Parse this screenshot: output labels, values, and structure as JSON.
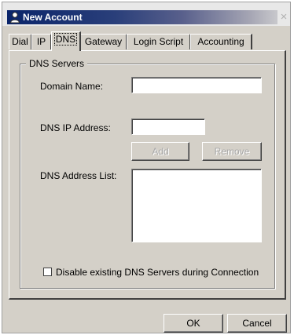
{
  "window": {
    "title": "New Account",
    "close_glyph": "×",
    "icon": "user-account-icon"
  },
  "tabs": [
    {
      "label": "Dial",
      "active": false
    },
    {
      "label": "IP",
      "active": false
    },
    {
      "label": "DNS",
      "active": true
    },
    {
      "label": "Gateway",
      "active": false
    },
    {
      "label": "Login Script",
      "active": false
    },
    {
      "label": "Accounting",
      "active": false
    }
  ],
  "dns": {
    "group_title": "DNS Servers",
    "domain_name_label": "Domain Name:",
    "domain_name_value": "",
    "ip_address_label": "DNS IP Address:",
    "ip_address_value": "",
    "add_label": "Add",
    "remove_label": "Remove",
    "address_list_label": "DNS Address List:",
    "address_list_items": [],
    "disable_checkbox_label": "Disable existing DNS Servers during Connection",
    "disable_checked": false
  },
  "footer": {
    "ok_label": "OK",
    "cancel_label": "Cancel"
  },
  "colors": {
    "face": "#d4d0c8",
    "title_start": "#0a246a",
    "title_end": "#c8c8cc"
  }
}
